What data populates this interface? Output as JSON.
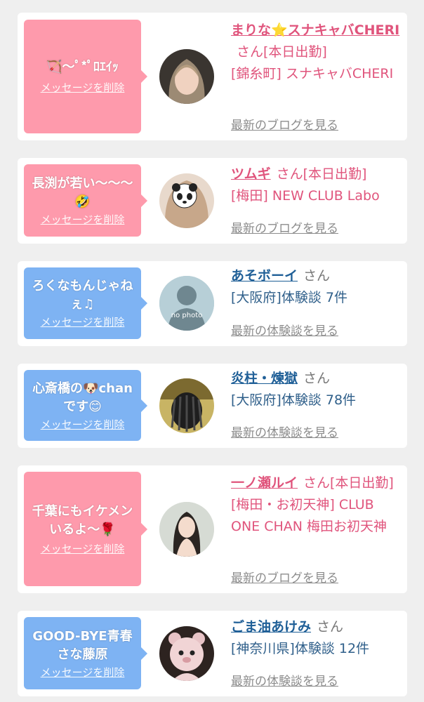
{
  "colors": {
    "page_bg": "#efefef",
    "pink_bubble": "#fe9aac",
    "blue_bubble": "#7eb3f3",
    "cast_name": "#e0547c",
    "user_name": "#1f5f97",
    "link_gray": "#8c8c8c"
  },
  "delete_label": "メッセージを削除",
  "items": [
    {
      "type": "cast",
      "message": "🏹〜ﾟ*ﾟﾛｴｲｯ",
      "delete_label": "メッセージを削除",
      "name": "まりな⭐スナキャバCHERI",
      "suffix": "さん[本日出勤]",
      "shop": "[錦糸町] スナキャバCHERI",
      "link": "最新のブログを見る"
    },
    {
      "type": "cast",
      "message": "長渕が若い〜〜〜🤣",
      "delete_label": "メッセージを削除",
      "name": "ツムギ",
      "suffix": "さん[本日出勤]",
      "shop": "[梅田] NEW CLUB Labo",
      "link": "最新のブログを見る"
    },
    {
      "type": "user",
      "message": "ろくなもんじゃねぇ♫",
      "delete_label": "メッセージを削除",
      "name": "あそボーイ",
      "suffix": "さん",
      "shop": "[大阪府]体験談 7件",
      "link": "最新の体験談を見る",
      "avatar_note": "no photo"
    },
    {
      "type": "user",
      "message": "心斎橋の🐶chanです😊",
      "delete_label": "メッセージを削除",
      "name": "炎柱・煉獄",
      "suffix": "さん",
      "shop": "[大阪府]体験談 78件",
      "link": "最新の体験談を見る"
    },
    {
      "type": "cast",
      "message": "千葉にもイケメンいるよ〜🌹",
      "delete_label": "メッセージを削除",
      "name": "一ノ瀬ルイ",
      "suffix": "さん[本日出勤]",
      "shop": "[梅田・お初天神] CLUB ONE CHAN 梅田お初天神",
      "link": "最新のブログを見る"
    },
    {
      "type": "user",
      "message": "GOOD-BYE青春さな藤原",
      "delete_label": "メッセージを削除",
      "name": "ごま油あけみ",
      "suffix": "さん",
      "shop": "[神奈川県]体験談 12件",
      "link": "最新の体験談を見る"
    }
  ]
}
